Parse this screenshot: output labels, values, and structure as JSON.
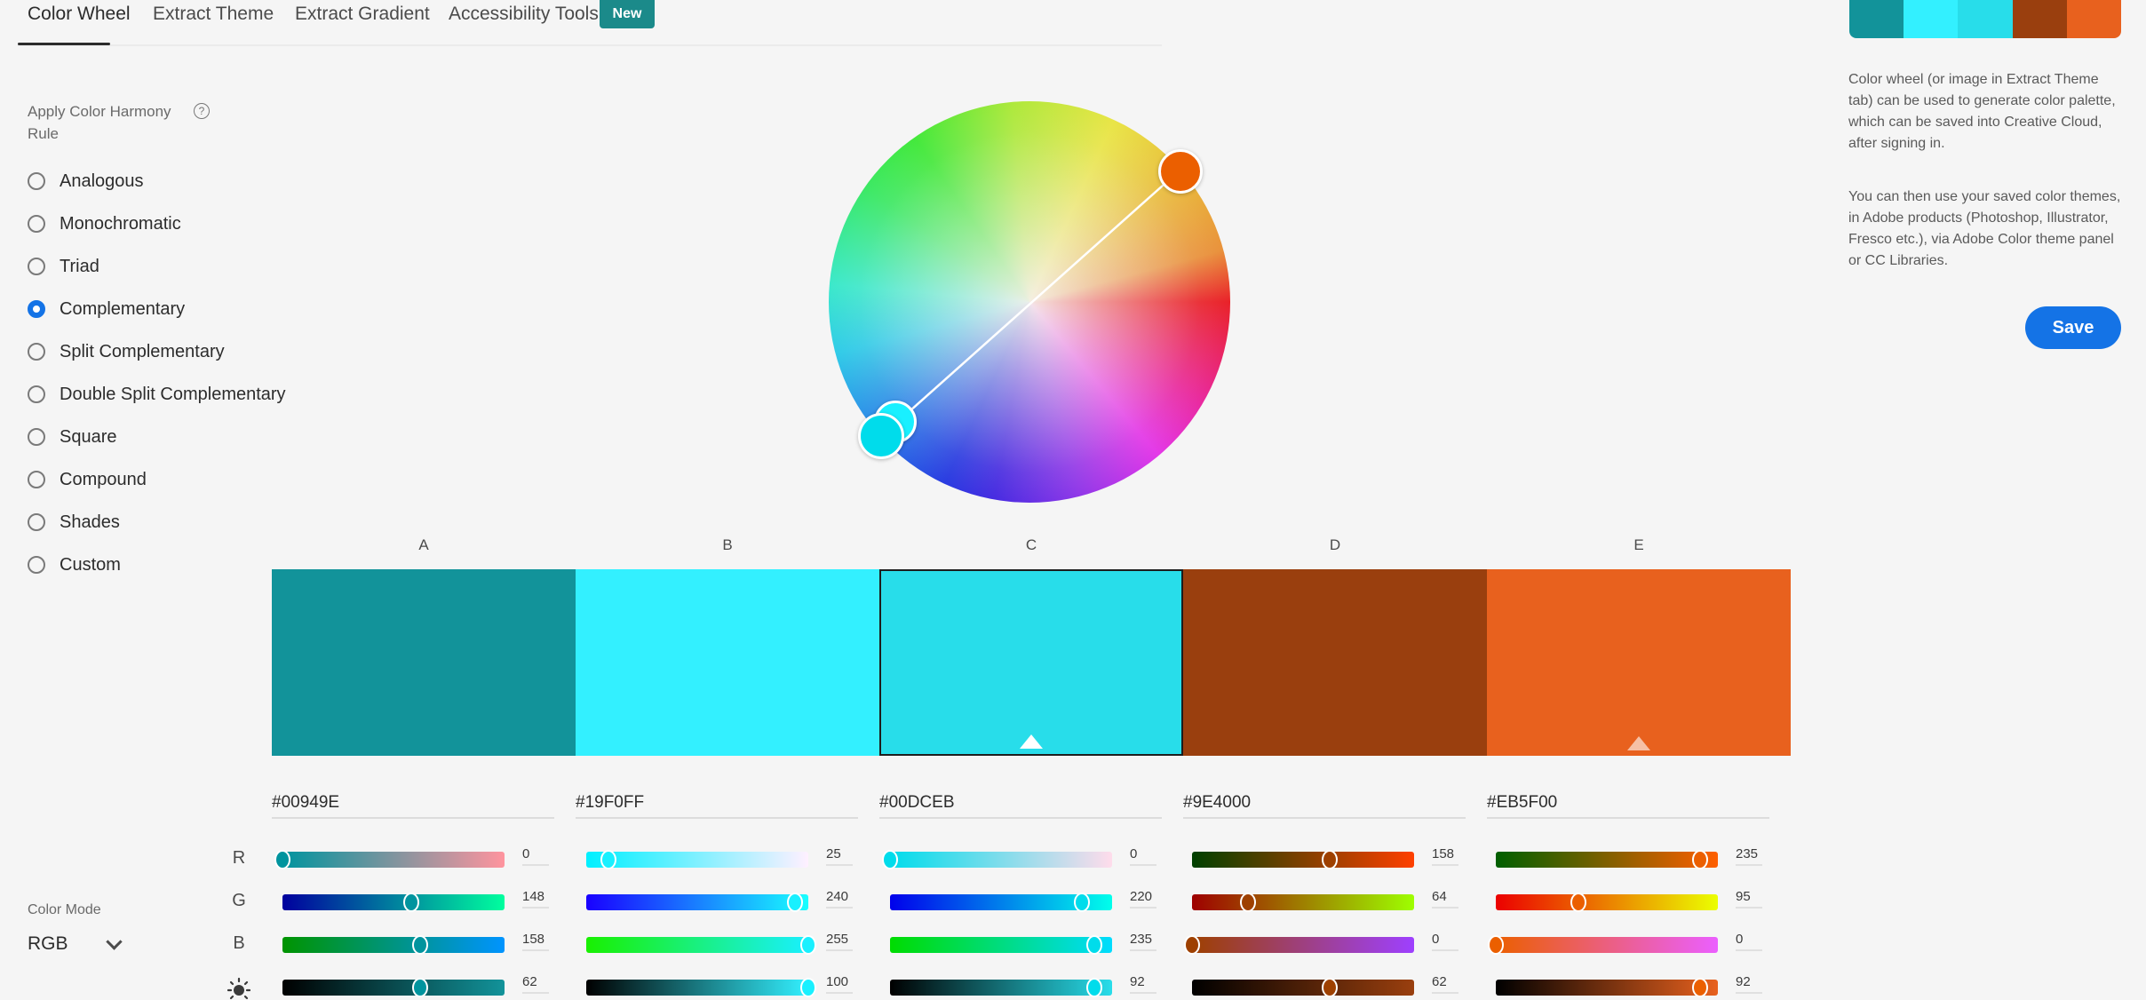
{
  "tabs": [
    {
      "label": "Color Wheel",
      "active": true
    },
    {
      "label": "Extract Theme",
      "active": false
    },
    {
      "label": "Extract Gradient",
      "active": false
    },
    {
      "label": "Accessibility Tools",
      "active": false
    }
  ],
  "new_badge": "New",
  "harmony": {
    "title": "Apply Color Harmony Rule",
    "help_icon": "?",
    "rules": [
      {
        "label": "Analogous",
        "checked": false
      },
      {
        "label": "Monochromatic",
        "checked": false
      },
      {
        "label": "Triad",
        "checked": false
      },
      {
        "label": "Complementary",
        "checked": true
      },
      {
        "label": "Split Complementary",
        "checked": false
      },
      {
        "label": "Double Split Complementary",
        "checked": false
      },
      {
        "label": "Square",
        "checked": false
      },
      {
        "label": "Compound",
        "checked": false
      },
      {
        "label": "Shades",
        "checked": false
      },
      {
        "label": "Custom",
        "checked": false
      }
    ]
  },
  "color_mode": {
    "label": "Color Mode",
    "value": "RGB"
  },
  "wheel": {
    "handles": [
      {
        "color": "#EB5F00",
        "role": "base"
      },
      {
        "color": "#19F0FF",
        "role": "B"
      },
      {
        "color": "#00DCEB",
        "role": "C"
      }
    ]
  },
  "row_labels": {
    "r": "R",
    "g": "G",
    "b": "B",
    "brightness_icon": "sun-icon"
  },
  "swatches": [
    {
      "label": "A",
      "hex": "#00949E",
      "display": "#12939A",
      "r": 0,
      "g": 148,
      "b": 158,
      "brightness": 62,
      "selected": false,
      "base": false
    },
    {
      "label": "B",
      "hex": "#19F0FF",
      "display": "#33F0FF",
      "r": 25,
      "g": 240,
      "b": 255,
      "brightness": 100,
      "selected": false,
      "base": false
    },
    {
      "label": "C",
      "hex": "#00DCEB",
      "display": "#28DDEA",
      "r": 0,
      "g": 220,
      "b": 235,
      "brightness": 92,
      "selected": true,
      "base": false
    },
    {
      "label": "D",
      "hex": "#9E4000",
      "display": "#9A3F0E",
      "r": 158,
      "g": 64,
      "b": 0,
      "brightness": 62,
      "selected": false,
      "base": false
    },
    {
      "label": "E",
      "hex": "#EB5F00",
      "display": "#E8611E",
      "r": 235,
      "g": 95,
      "b": 0,
      "brightness": 92,
      "selected": false,
      "base": true
    }
  ],
  "info": {
    "paragraph1": "Color wheel (or image in Extract Theme tab) can be used to generate color palette, which can be saved into Creative Cloud, after signing in.",
    "paragraph2": "You can then use your saved color themes, in Adobe products (Photoshop, Illustrator, Fresco etc.), via Adobe Color theme panel or CC Libraries."
  },
  "save_label": "Save"
}
